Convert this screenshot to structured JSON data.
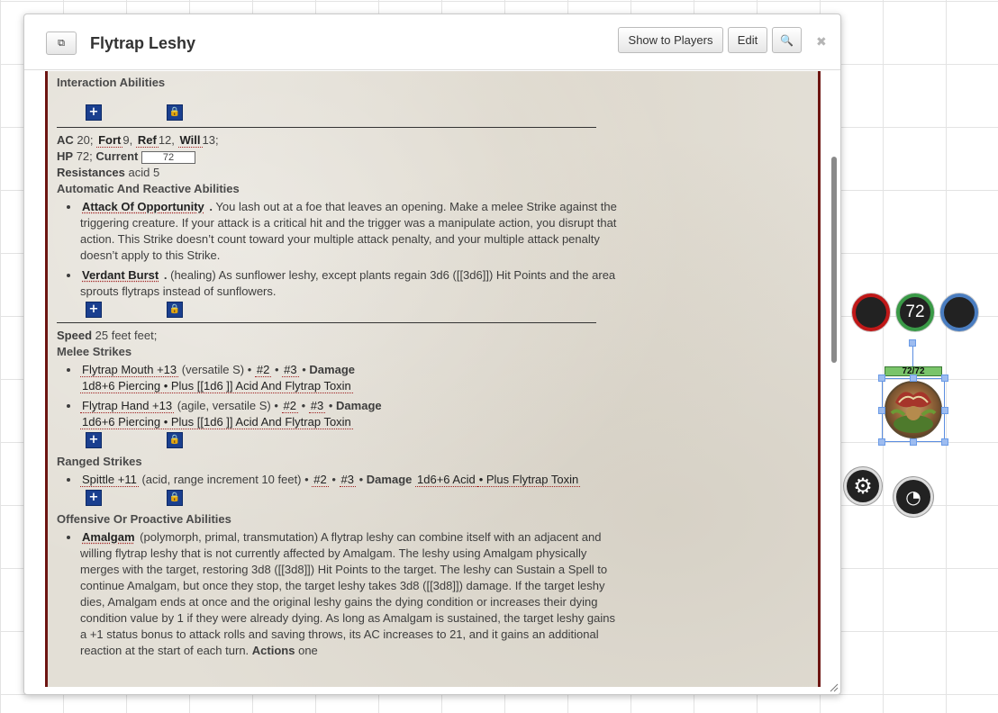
{
  "dialog": {
    "title": "Flytrap Leshy",
    "show_to_players": "Show to Players",
    "edit": "Edit",
    "popout_icon": "⧉",
    "search_icon": "🔍",
    "close_icon": "✖"
  },
  "sheet": {
    "interaction_title": "Interaction Abilities",
    "ac_label": "AC",
    "ac_value": "20;",
    "fort_label": "Fort",
    "fort_value": "9,",
    "ref_label": "Ref",
    "ref_value": "12,",
    "will_label": "Will",
    "will_value": "13;",
    "hp_label": "HP",
    "hp_value": "72;",
    "current_label": "Current",
    "current_value": "72",
    "resistances_label": "Resistances",
    "resistances_value": "acid 5",
    "auto_title": "Automatic And Reactive Abilities",
    "aoo_name": "Attack Of Opportunity",
    "aoo_text": "You lash out at a foe that leaves an opening. Make a melee Strike against the triggering creature. If your attack is a critical hit and the trigger was a manipulate action, you disrupt that action. This Strike doesn’t count toward your multiple attack penalty, and your multiple attack penalty doesn’t apply to this Strike.",
    "verdant_name": "Verdant Burst",
    "verdant_text": "(healing) As sunflower leshy, except plants regain 3d6 ([[3d6]]) Hit Points and the area sprouts flytraps instead of sunflowers.",
    "speed_label": "Speed",
    "speed_value": "25 feet feet;",
    "melee_title": "Melee Strikes",
    "mouth_name": "Flytrap Mouth  +13",
    "mouth_traits": "(versatile S) •",
    "mouth_map2": "#2",
    "mouth_map3": "#3",
    "damage_label": "Damage",
    "mouth_damage": "1d8+6   Piercing • Plus [[1d6 ]] Acid And Flytrap Toxin",
    "hand_name": "Flytrap Hand  +13",
    "hand_traits": "(agile, versatile S) •",
    "hand_map2": "#2",
    "hand_map3": "#3",
    "hand_damage": "1d6+6   Piercing • Plus [[1d6 ]] Acid And Flytrap Toxin",
    "ranged_title": "Ranged Strikes",
    "spittle_name": "Spittle  +11",
    "spittle_traits": "(acid, range increment 10 feet) •",
    "spittle_map2": "#2",
    "spittle_map3": "#3",
    "spittle_damage": "1d6+6   Acid",
    "spittle_plus": "• Plus Flytrap Toxin",
    "offensive_title": "Offensive Or Proactive Abilities",
    "amalgam_name": "Amalgam",
    "amalgam_text": "(polymorph, primal, transmutation) A flytrap leshy can combine itself with an adjacent and willing flytrap leshy that is not currently affected by Amalgam. The leshy using Amalgam physically merges with the target, restoring 3d8 ([[3d8]]) Hit Points to the target. The leshy can Sustain a Spell to continue Amalgam, but once they stop, the target leshy takes 3d8 ([[3d8]]) damage. If the target leshy dies, Amalgam ends at once and the original leshy gains the dying condition or increases their dying condition value by 1 if they were already dying. As long as Amalgam is sustained, the target leshy gains a +1 status bonus to attack rolls and saving throws, its AC increases to 21, and it gains an additional reaction at the start of each turn.",
    "actions_label": "Actions",
    "actions_value": "one"
  },
  "token": {
    "bar1": "",
    "bar2": "72",
    "bar3": "",
    "hp_bar": "72/72",
    "gear_icon": "⚙",
    "gauge_icon": "◔",
    "colors": {
      "red": "#c01818",
      "green": "#3a9a47",
      "blue": "#4a7dc0"
    }
  }
}
